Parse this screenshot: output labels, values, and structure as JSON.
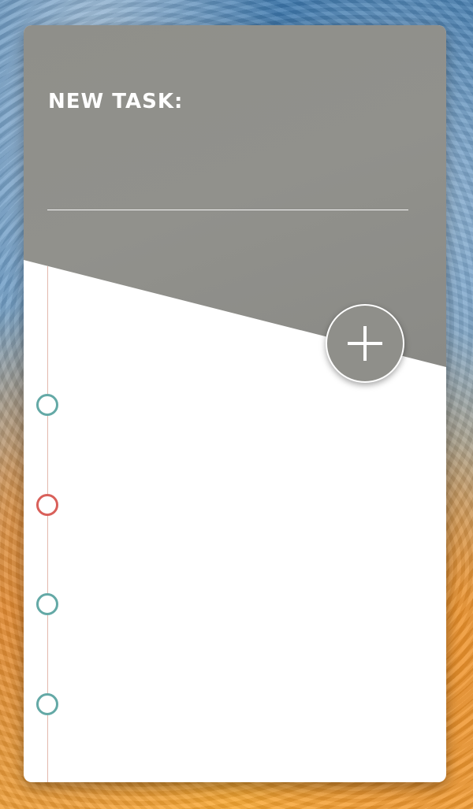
{
  "header": {
    "title": "NEW TASK:",
    "input_value": "",
    "input_placeholder": ""
  },
  "add_button": {
    "icon": "plus-icon"
  },
  "tasks": [
    {
      "label": "",
      "status_color": "#64a9a6"
    },
    {
      "label": "",
      "status_color": "#d9605a"
    },
    {
      "label": "",
      "status_color": "#64a9a6"
    },
    {
      "label": "",
      "status_color": "#64a9a6"
    }
  ],
  "colors": {
    "panel": "#8f8f8a",
    "teal": "#64a9a6",
    "red": "#d9605a",
    "timeline": "#e3b9ad"
  }
}
